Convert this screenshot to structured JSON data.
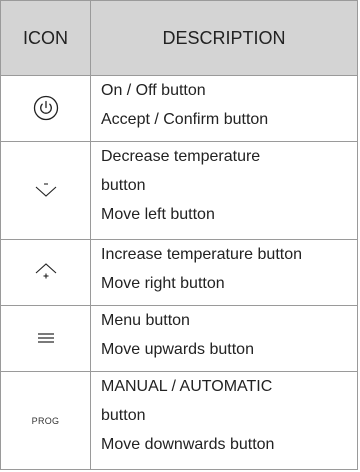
{
  "header": {
    "icon": "ICON",
    "description": "DESCRIPTION"
  },
  "rows": [
    {
      "icon": "power-icon",
      "lines": [
        "On / Off button",
        "Accept / Confirm button"
      ]
    },
    {
      "icon": "chevron-down-minus-icon",
      "lines": [
        "Decrease temperature",
        "button",
        "Move left button"
      ]
    },
    {
      "icon": "chevron-up-plus-icon",
      "lines": [
        "Increase temperature button",
        "Move right button"
      ]
    },
    {
      "icon": "menu-icon",
      "lines": [
        "Menu button",
        "Move upwards button"
      ]
    },
    {
      "icon": "prog-icon",
      "icon_text": "PROG",
      "lines": [
        "MANUAL / AUTOMATIC",
        "button",
        "Move downwards button"
      ]
    }
  ]
}
